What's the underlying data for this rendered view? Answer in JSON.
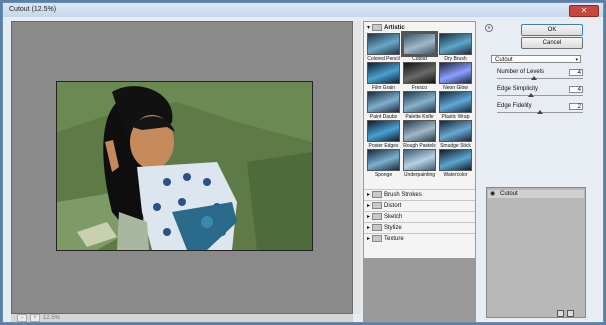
{
  "window": {
    "title": "Cutout (12.5%)",
    "close_label": "✕"
  },
  "preview": {
    "zoom_value": "12.5%",
    "zoom_minus": "−",
    "zoom_plus": "+"
  },
  "gallery": {
    "open_category": "Artistic",
    "filters": [
      {
        "label": "Colored Pencil",
        "colors": [
          "#223445",
          "#6aa6c8"
        ]
      },
      {
        "label": "Cutout",
        "colors": [
          "#3b5568",
          "#9fb9c8"
        ],
        "selected": true
      },
      {
        "label": "Dry Brush",
        "colors": [
          "#1b2c3d",
          "#5fa6c8"
        ]
      },
      {
        "label": "Film Grain",
        "colors": [
          "#0f2130",
          "#4aa0d0"
        ]
      },
      {
        "label": "Fresco",
        "colors": [
          "#121212",
          "#6a6a6a"
        ]
      },
      {
        "label": "Neon Glow",
        "colors": [
          "#1b2740",
          "#8aa0ff"
        ]
      },
      {
        "label": "Paint Daubs",
        "colors": [
          "#1b2b3b",
          "#7fb0d0"
        ]
      },
      {
        "label": "Palette Knife",
        "colors": [
          "#20374a",
          "#86b3cc"
        ]
      },
      {
        "label": "Plastic Wrap",
        "colors": [
          "#182838",
          "#5fa8d8"
        ]
      },
      {
        "label": "Poster Edges",
        "colors": [
          "#0f1c2a",
          "#4aa0d0"
        ]
      },
      {
        "label": "Rough Pastels",
        "colors": [
          "#2a3a4a",
          "#a0b8c8"
        ]
      },
      {
        "label": "Smudge Stick",
        "colors": [
          "#152535",
          "#6aa8d0"
        ]
      },
      {
        "label": "Sponge",
        "colors": [
          "#182838",
          "#7ab0d0"
        ]
      },
      {
        "label": "Underpainting",
        "colors": [
          "#3a5a7a",
          "#b8d0e0"
        ]
      },
      {
        "label": "Watercolor",
        "colors": [
          "#0f1c28",
          "#5aa6d0"
        ]
      }
    ],
    "categories": [
      "Brush Strokes",
      "Distort",
      "Sketch",
      "Stylize",
      "Texture"
    ]
  },
  "controls": {
    "collapse_icon": "«",
    "ok_label": "OK",
    "cancel_label": "Cancel",
    "filter_select": "Cutout",
    "params": [
      {
        "label": "Number of Levels",
        "value": "4",
        "fraction": 0.43
      },
      {
        "label": "Edge Simplicity",
        "value": "4",
        "fraction": 0.4
      },
      {
        "label": "Edge Fidelity",
        "value": "2",
        "fraction": 0.5
      }
    ]
  },
  "layers": {
    "items": [
      "Cutout"
    ]
  },
  "colors": {
    "accent": "#3c7fb1",
    "photo_bg": "#5d7a47",
    "preview_bg": "#8a8a8a"
  }
}
